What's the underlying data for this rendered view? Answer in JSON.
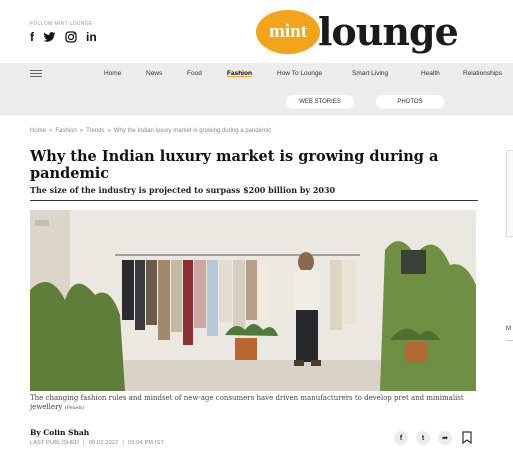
{
  "header": {
    "follow_label": "FOLLOW MINT LOUNGE",
    "social_icons": [
      "facebook-icon",
      "twitter-icon",
      "instagram-icon",
      "linkedin-icon"
    ],
    "social_glyphs": {
      "facebook": "f",
      "twitter": "🐦",
      "instagram": "◎",
      "linkedin": "in"
    },
    "logo_mint": "mint",
    "logo_lounge": "lounge",
    "brand_color": "#f4a41b"
  },
  "nav": {
    "items": [
      "Home",
      "News",
      "Food",
      "Fashion",
      "How To Lounge",
      "Smart Living",
      "Health",
      "Relationships"
    ],
    "active": "Fashion"
  },
  "subnav": {
    "web_stories": "WEB STORIES",
    "photos": "PHOTOS"
  },
  "breadcrumb": {
    "items": [
      "Home",
      "Fashion",
      "Trends",
      "Why the Indian luxury market is growing during a pandemic"
    ],
    "separator": "»"
  },
  "article": {
    "title": "Why the Indian luxury market is growing during a pandemic",
    "subtitle": "The size of the industry is projected to surpass $200 billion by 2030",
    "caption": "The changing fashion rules and mindset of new-age consumers have driven manufacturers to develop pret and minimalist jewellery ",
    "caption_credit": "(Pexels)",
    "byline": "By Colin Shah",
    "last_published_label": "LAST PUBLISHED",
    "date": "08.02.2022",
    "time": "03:04 PM IST"
  },
  "side": {
    "letter": "M"
  },
  "share": {
    "facebook": "f",
    "twitter": "t",
    "share": "➦"
  }
}
